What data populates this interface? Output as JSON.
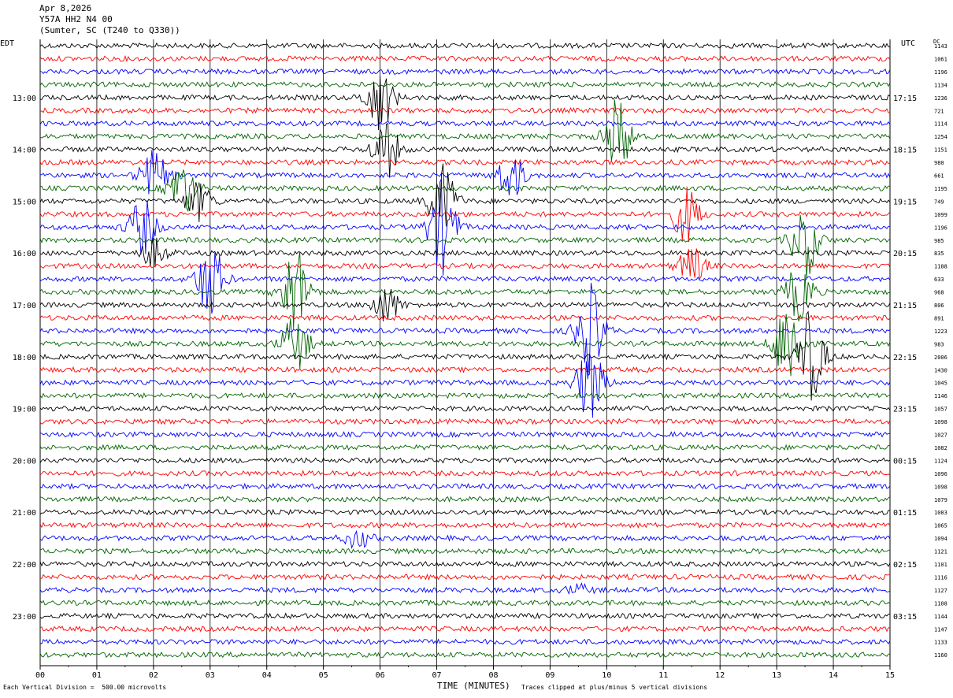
{
  "header": {
    "date": "Apr 8,2026",
    "station": "Y57A HH2 N4 00",
    "location": "(Sumter, SC (T240 to Q330))"
  },
  "left_tz": "EDT",
  "right_tz": "UTC",
  "dc_header": "DC",
  "footer": {
    "scale_note": "Each Vertical Division =  500.00 microvolts",
    "xlabel": "TIME (MINUTES)",
    "clip_note": "Traces clipped at plus/minus 5 vertical divisions"
  },
  "colors": {
    "black": "#000000",
    "red": "#ff0000",
    "blue": "#0000ff",
    "green": "#006400"
  },
  "chart_data": {
    "type": "line",
    "xlabel": "TIME (MINUTES)",
    "xlim": [
      0,
      15
    ],
    "x_ticks": [
      "00",
      "01",
      "02",
      "03",
      "04",
      "05",
      "06",
      "07",
      "08",
      "09",
      "10",
      "11",
      "12",
      "13",
      "14",
      "15"
    ],
    "trace_colors": [
      "black",
      "red",
      "blue",
      "green"
    ],
    "left_hour_labels": [
      "13:00",
      "14:00",
      "15:00",
      "16:00",
      "17:00",
      "18:00",
      "19:00",
      "20:00",
      "21:00",
      "22:00",
      "23:00"
    ],
    "right_hour_labels": [
      "17:15",
      "18:15",
      "19:15",
      "20:15",
      "21:15",
      "22:15",
      "23:15",
      "00:15",
      "01:15",
      "02:15",
      "03:15"
    ],
    "dc_offsets": [
      1143,
      1061,
      1196,
      1134,
      1236,
      721,
      1114,
      1254,
      1151,
      980,
      661,
      1195,
      749,
      1099,
      1196,
      985,
      835,
      1188,
      633,
      968,
      806,
      891,
      1223,
      983,
      2006,
      1430,
      1045,
      1146,
      1057,
      1098,
      1027,
      1082,
      1124,
      1096,
      1098,
      1079,
      1083,
      1065,
      1094,
      1121,
      1101,
      1116,
      1127,
      1108,
      1144,
      1147,
      1133,
      1160
    ],
    "events": [
      {
        "row": 4,
        "minute": 6.0,
        "amp": 3.5
      },
      {
        "row": 7,
        "minute": 10.2,
        "amp": 4.0
      },
      {
        "row": 8,
        "minute": 6.1,
        "amp": 3.0
      },
      {
        "row": 10,
        "minute": 2.0,
        "amp": 2.5
      },
      {
        "row": 10,
        "minute": 8.3,
        "amp": 2.5
      },
      {
        "row": 11,
        "minute": 2.5,
        "amp": 3.0
      },
      {
        "row": 12,
        "minute": 2.8,
        "amp": 2.0
      },
      {
        "row": 12,
        "minute": 7.1,
        "amp": 4.0
      },
      {
        "row": 13,
        "minute": 11.4,
        "amp": 3.0
      },
      {
        "row": 14,
        "minute": 1.8,
        "amp": 3.0
      },
      {
        "row": 14,
        "minute": 7.1,
        "amp": 5.0
      },
      {
        "row": 15,
        "minute": 13.5,
        "amp": 4.0
      },
      {
        "row": 16,
        "minute": 2.0,
        "amp": 1.5
      },
      {
        "row": 17,
        "minute": 11.5,
        "amp": 2.0
      },
      {
        "row": 18,
        "minute": 3.0,
        "amp": 4.0
      },
      {
        "row": 19,
        "minute": 4.5,
        "amp": 5.0
      },
      {
        "row": 19,
        "minute": 13.4,
        "amp": 3.0
      },
      {
        "row": 20,
        "minute": 6.1,
        "amp": 2.0
      },
      {
        "row": 22,
        "minute": 9.7,
        "amp": 5.0
      },
      {
        "row": 23,
        "minute": 4.5,
        "amp": 3.0
      },
      {
        "row": 23,
        "minute": 13.2,
        "amp": 5.0
      },
      {
        "row": 24,
        "minute": 13.6,
        "amp": 5.0
      },
      {
        "row": 26,
        "minute": 9.7,
        "amp": 4.0
      },
      {
        "row": 38,
        "minute": 5.6,
        "amp": 1.0
      },
      {
        "row": 42,
        "minute": 9.5,
        "amp": 0.5
      }
    ]
  }
}
